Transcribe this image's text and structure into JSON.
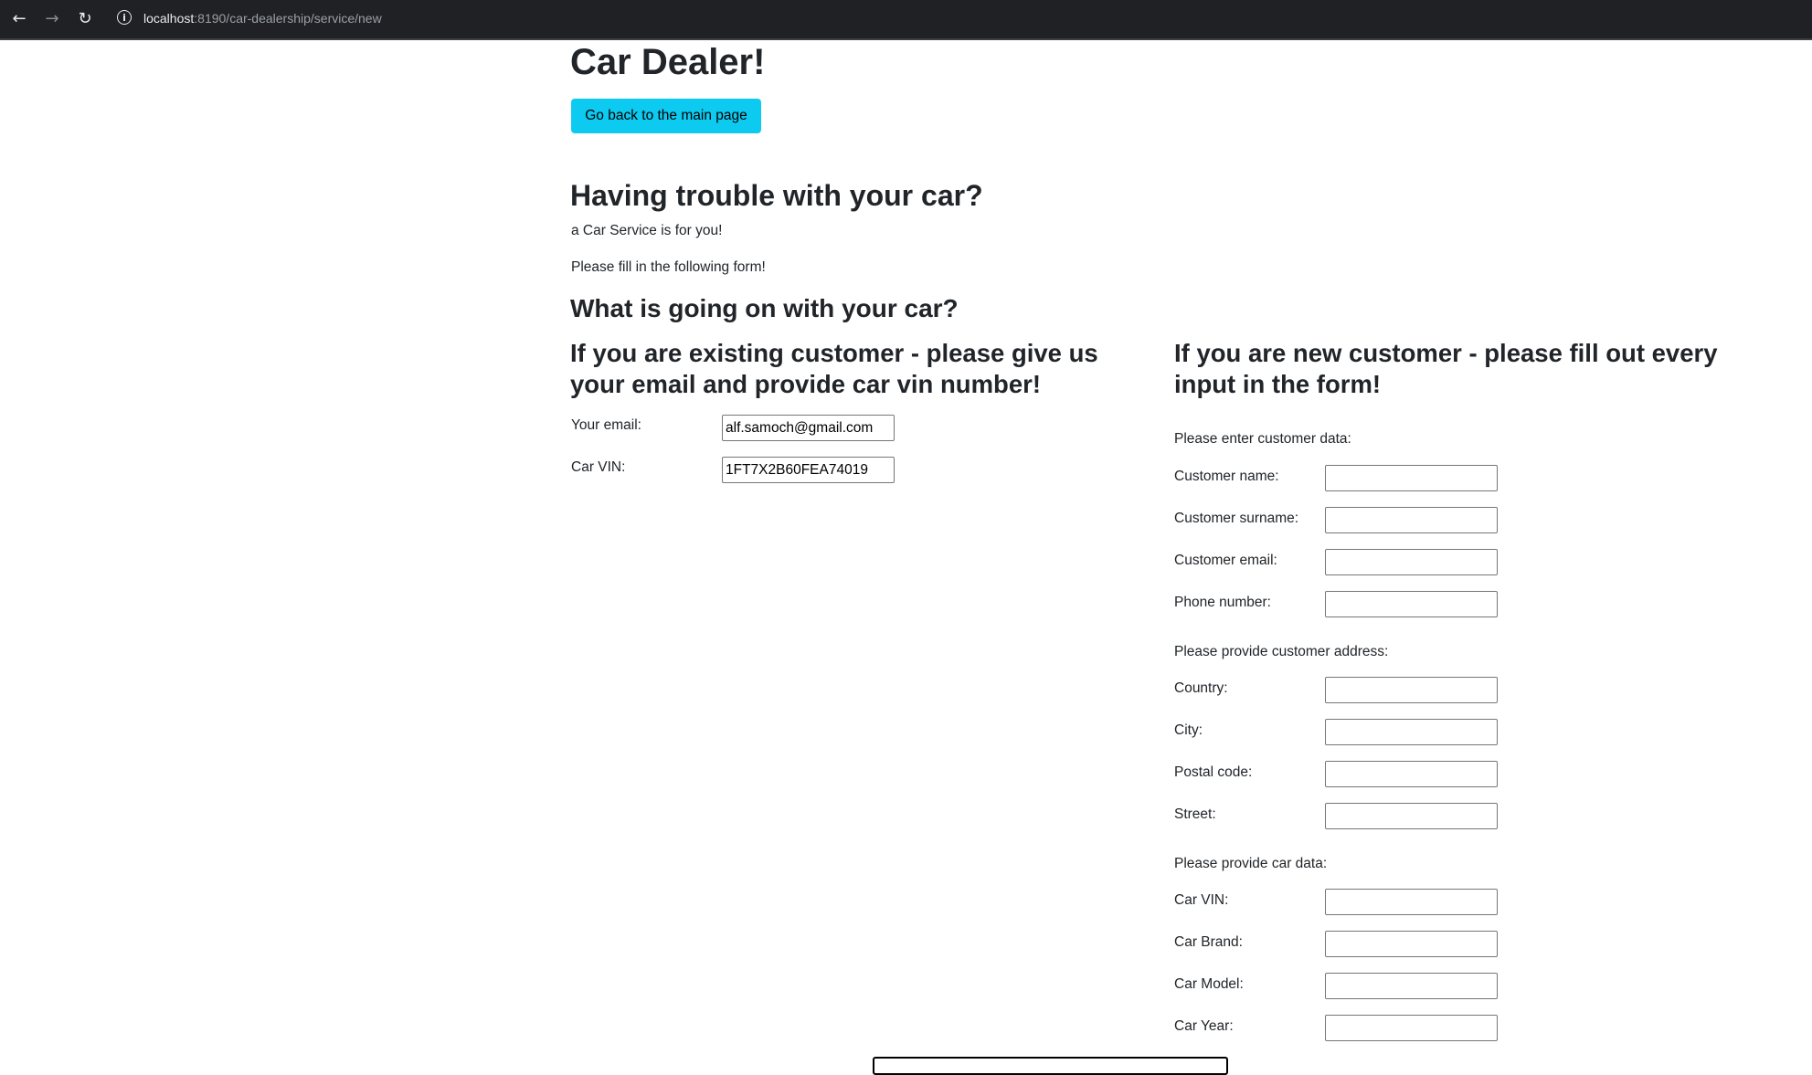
{
  "browser": {
    "url_host": "localhost",
    "url_path": ":8190/car-dealership/service/new",
    "back_icon": "arrow-left",
    "forward_icon": "arrow-right",
    "reload_icon": "reload",
    "info_icon": "info"
  },
  "page": {
    "title": "Car Dealer!",
    "back_button": "Go back to the main page",
    "heading": "Having trouble with your car?",
    "subtitle": "a Car Service is for you!",
    "instruction": "Please fill in the following form!",
    "question": "What is going on with your car?"
  },
  "existing_customer": {
    "heading": "If you are existing customer - please give us your email and provide car vin number!",
    "email_label": "Your email:",
    "email_value": "alf.samoch@gmail.com",
    "vin_label": "Car VIN:",
    "vin_value": "1FT7X2B60FEA74019"
  },
  "new_customer": {
    "heading": "If you are new customer - please fill out every input in the form!",
    "customer_section": "Please enter customer data:",
    "name_label": "Customer name:",
    "surname_label": "Customer surname:",
    "email_label": "Customer email:",
    "phone_label": "Phone number:",
    "address_section": "Please provide customer address:",
    "country_label": "Country:",
    "city_label": "City:",
    "postal_label": "Postal code:",
    "street_label": "Street:",
    "car_section": "Please provide car data:",
    "vin_label": "Car VIN:",
    "brand_label": "Car Brand:",
    "model_label": "Car Model:",
    "year_label": "Car Year:"
  }
}
